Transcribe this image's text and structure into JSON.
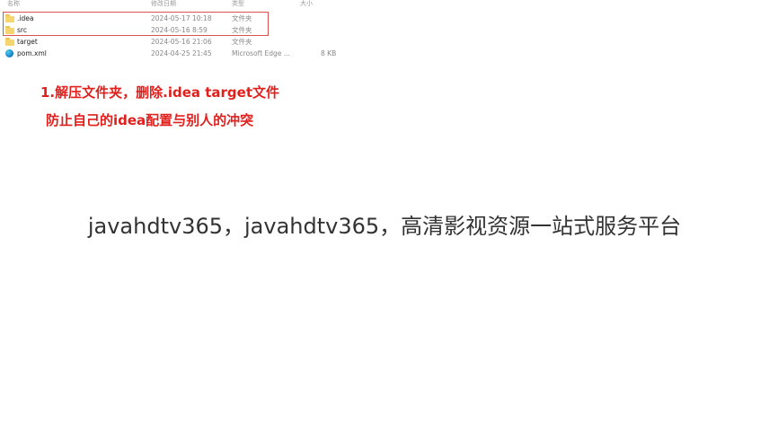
{
  "explorer": {
    "columns": {
      "name": "名称",
      "date_modified": "修改日期",
      "type": "类型",
      "size": "大小"
    },
    "files": [
      {
        "name": ".idea",
        "date": "2024-05-17 10:18",
        "type": "文件夹",
        "size": "",
        "icon": "folder-icon"
      },
      {
        "name": "src",
        "date": "2024-05-16 8:59",
        "type": "文件夹",
        "size": "",
        "icon": "folder-icon"
      },
      {
        "name": "target",
        "date": "2024-05-16 21:06",
        "type": "文件夹",
        "size": "",
        "icon": "folder-icon"
      },
      {
        "name": "pom.xml",
        "date": "2024-04-25 21:45",
        "type": "Microsoft Edge ...",
        "size": "8 KB",
        "icon": "edge-icon"
      }
    ],
    "highlight_color": "#d9534f"
  },
  "annotation": {
    "line1": "1.解压文件夹，删除.idea  target文件",
    "line2": "防止自己的idea配置与别人的冲突",
    "color": "#e0201d"
  },
  "watermark": {
    "text": "javahdtv365，javahdtv365，高清影视资源一站式服务平台"
  }
}
